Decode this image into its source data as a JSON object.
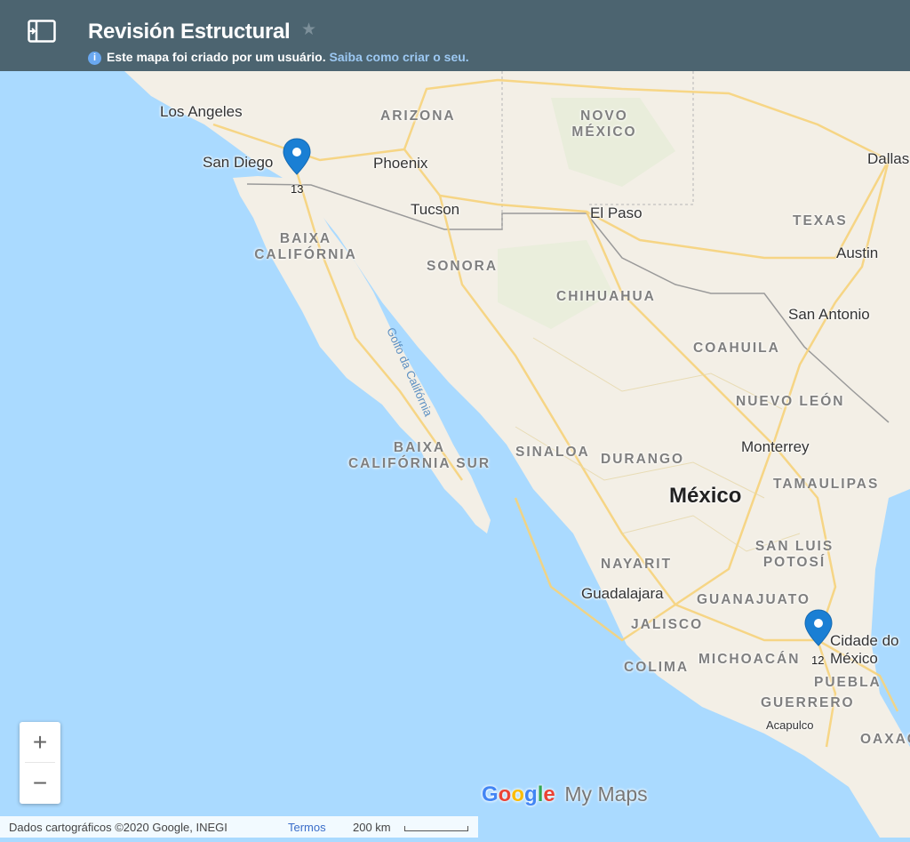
{
  "header": {
    "title": "Revisión Estructural",
    "star_icon": "star-icon",
    "panel_icon": "side-panel-toggle-icon",
    "info_text": "Este mapa foi criado por um usuário.",
    "info_link": "Saiba como criar o seu."
  },
  "map": {
    "cities": [
      {
        "name": "Los Angeles"
      },
      {
        "name": "San Diego"
      },
      {
        "name": "Phoenix"
      },
      {
        "name": "Tucson"
      },
      {
        "name": "El Paso"
      },
      {
        "name": "Dallas"
      },
      {
        "name": "Austin"
      },
      {
        "name": "San Antonio"
      },
      {
        "name": "Monterrey"
      },
      {
        "name": "Guadalajara"
      },
      {
        "name": "Cidade do México"
      },
      {
        "name": "Acapulco"
      }
    ],
    "states": [
      "ARIZONA",
      "NOVO MÉXICO",
      "TEXAS",
      "BAIXA CALIFÓRNIA",
      "SONORA",
      "CHIHUAHUA",
      "COAHUILA",
      "NUEVO LEÓN",
      "BAIXA CALIFÓRNIA SUR",
      "SINALOA",
      "DURANGO",
      "TAMAULIPAS",
      "SAN LUIS POTOSÍ",
      "NAYARIT",
      "GUANAJUATO",
      "JALISCO",
      "COLIMA",
      "MICHOACÁN",
      "PUEBLA",
      "GUERRERO",
      "OAXACA"
    ],
    "country": "México",
    "sea_label": "Golfo da Califórnia",
    "markers": [
      {
        "name": "San Diego marker",
        "count": "13",
        "color": "#1a7fd4"
      },
      {
        "name": "Mexico City marker",
        "count": "12",
        "color": "#1a7fd4"
      }
    ]
  },
  "controls": {
    "zoom_in": "+",
    "zoom_out": "−"
  },
  "branding": {
    "google": "Google",
    "my_maps": "My Maps"
  },
  "footer": {
    "data": "Dados cartográficos ©2020 Google, INEGI",
    "terms": "Termos",
    "scale": "200 km"
  },
  "colors": {
    "header": "#4c6470",
    "water": "#aadaff",
    "land": "#f3efe6",
    "roads": "#f7d37b"
  }
}
